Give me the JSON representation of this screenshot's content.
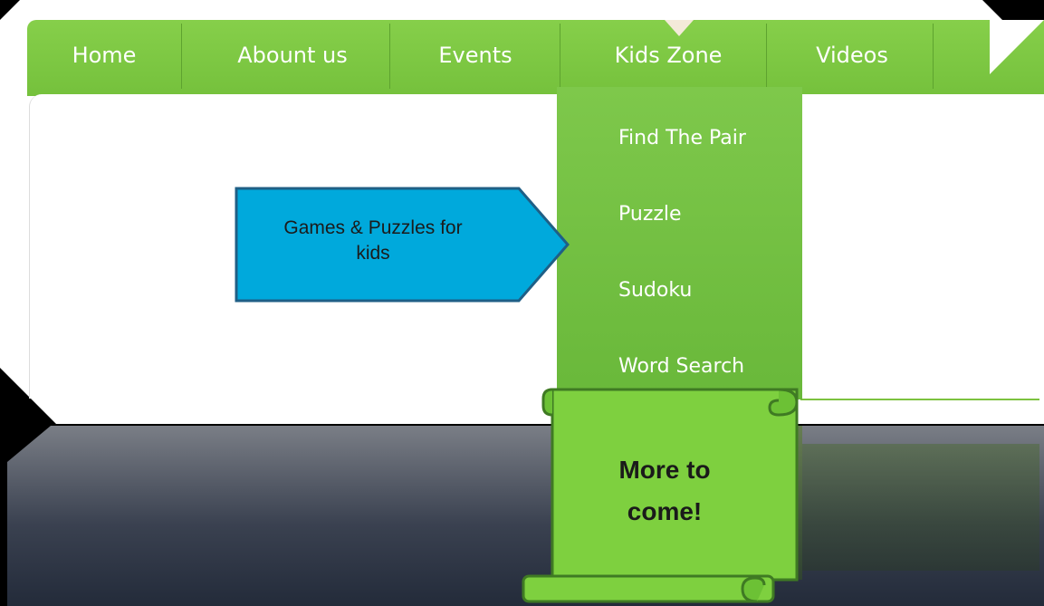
{
  "nav": {
    "items": [
      {
        "label": "Home"
      },
      {
        "label": "Abount us"
      },
      {
        "label": "Events"
      },
      {
        "label": "Kids Zone"
      },
      {
        "label": "Videos"
      }
    ]
  },
  "dropdown": {
    "items": [
      {
        "label": "Find The Pair"
      },
      {
        "label": "Puzzle"
      },
      {
        "label": "Sudoku"
      },
      {
        "label": "Word Search"
      }
    ]
  },
  "callout": {
    "line1": "Games & Puzzles for",
    "line2": "kids"
  },
  "banner": {
    "line1": "More to",
    "line2": "come!"
  },
  "colors": {
    "nav_green": "#7cc842",
    "callout_blue": "#00a9dc",
    "banner_green": "#7ed03f"
  }
}
